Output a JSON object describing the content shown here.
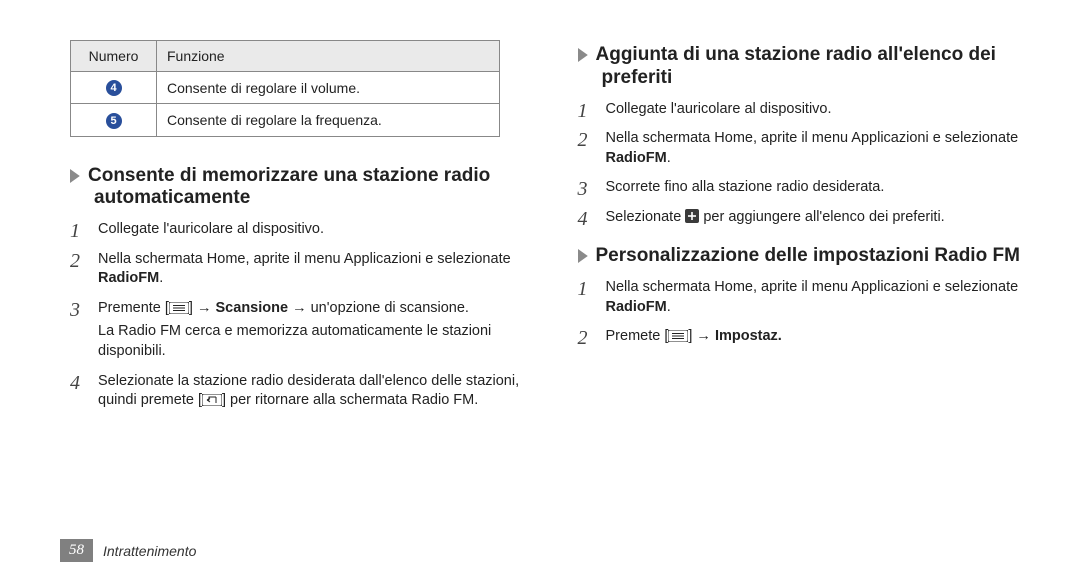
{
  "table": {
    "headers": {
      "col1": "Numero",
      "col2": "Funzione"
    },
    "rows": [
      {
        "num": "4",
        "fn": "Consente di regolare il volume."
      },
      {
        "num": "5",
        "fn": "Consente di regolare la frequenza."
      }
    ]
  },
  "left": {
    "heading": "Consente di memorizzare una stazione radio automaticamente",
    "steps": {
      "s1": "Collegate l'auricolare al dispositivo.",
      "s2a": "Nella schermata Home, aprite il menu Applicazioni e selezionate ",
      "s2b": "RadioFM",
      "s2c": ".",
      "s3a": "Premente [",
      "s3b": "] → ",
      "s3c": "Scansione",
      "s3d": " → un'opzione di scansione.",
      "s3sub": "La Radio FM cerca e memorizza automaticamente le stazioni disponibili.",
      "s4a": "Selezionate la stazione radio desiderata dall'elenco delle stazioni, quindi premete [",
      "s4b": "] per ritornare alla schermata Radio FM."
    }
  },
  "rightA": {
    "heading": "Aggiunta di una stazione radio all'elenco dei preferiti",
    "steps": {
      "s1": "Collegate l'auricolare al dispositivo.",
      "s2a": "Nella schermata Home, aprite il menu Applicazioni e selezionate ",
      "s2b": "RadioFM",
      "s2c": ".",
      "s3": "Scorrete fino alla stazione radio desiderata.",
      "s4a": "Selezionate ",
      "s4b": " per aggiungere all'elenco dei preferiti."
    }
  },
  "rightB": {
    "heading": "Personalizzazione delle impostazioni Radio FM",
    "steps": {
      "s1a": "Nella schermata Home, aprite il menu Applicazioni e selezionate ",
      "s1b": "RadioFM",
      "s1c": ".",
      "s2a": "Premete [",
      "s2b": "] → ",
      "s2c": "Impostaz."
    }
  },
  "footer": {
    "page": "58",
    "section": "Intrattenimento"
  },
  "icons": {
    "chev": "chevron-right",
    "menu": "menu-key",
    "back": "back-key",
    "plus": "plus-box"
  }
}
